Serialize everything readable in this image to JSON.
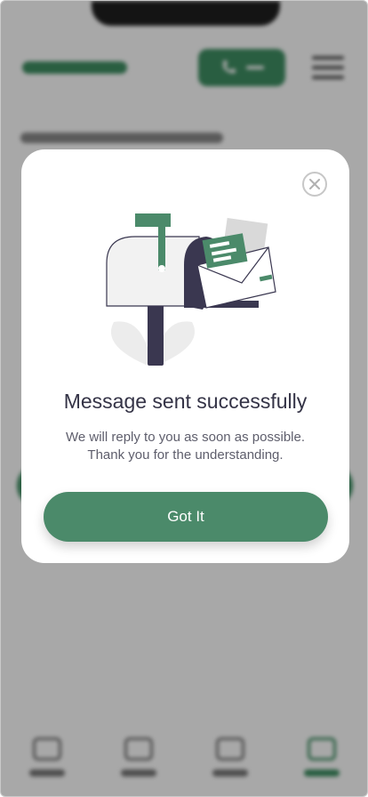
{
  "colors": {
    "accent": "#4b8a6a",
    "brand_green": "#3f8f63",
    "title_text": "#343346",
    "body_text": "#5e5e6c",
    "close_icon": "#c7c7c7",
    "mailbox_navy": "#3a3750"
  },
  "modal": {
    "close_icon": "close-icon",
    "illustration": "mailbox-illustration",
    "title": "Message sent successfully",
    "message_line1": "We will reply to you as soon as possible.",
    "message_line2": "Thank you for the understanding.",
    "button_label": "Got It"
  },
  "background": {
    "logo_icon": "brand-logo",
    "call_icon": "phone-icon",
    "menu_icon": "hamburger-menu-icon",
    "bottom_nav_icons": [
      "nav-icon-1",
      "nav-icon-2",
      "nav-icon-3",
      "nav-icon-4"
    ],
    "active_nav_index": 4
  }
}
